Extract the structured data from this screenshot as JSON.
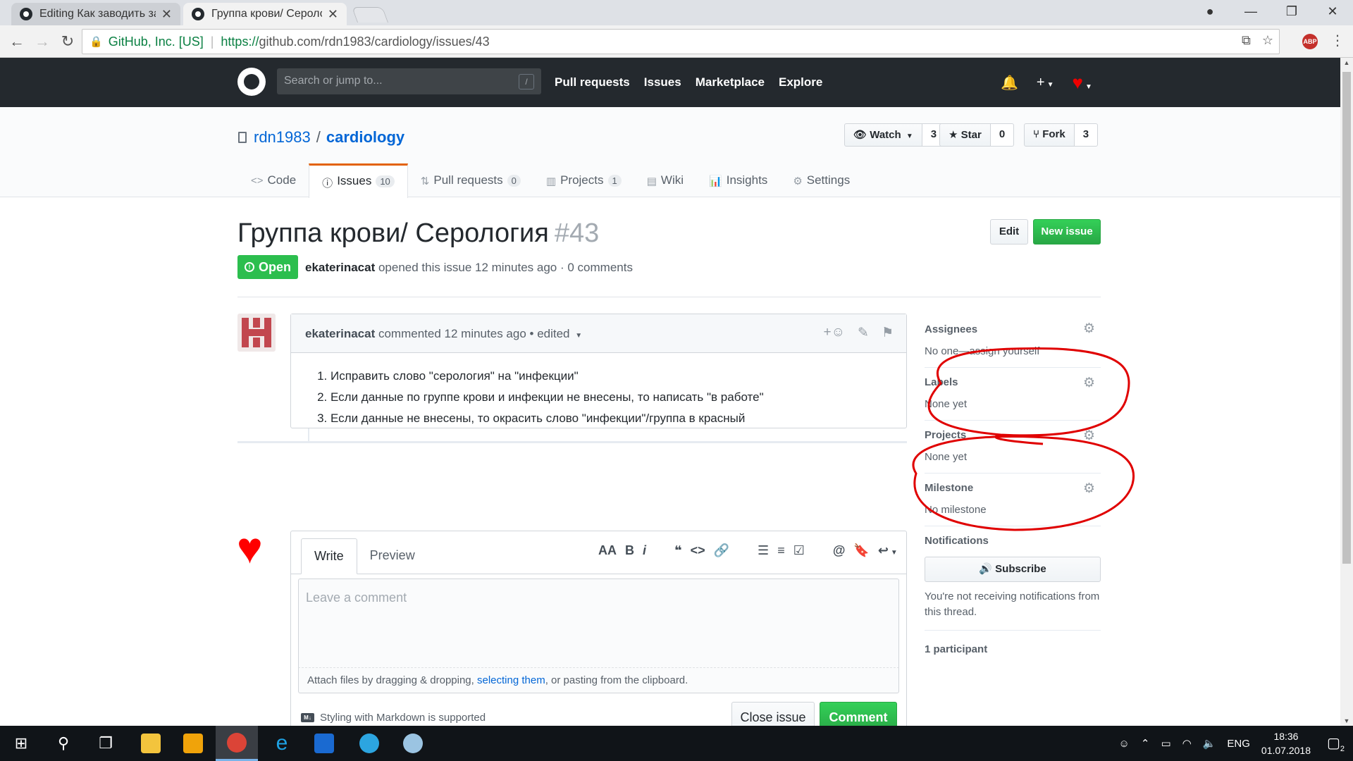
{
  "browser": {
    "tabs": [
      {
        "title": "Editing Как заводить зад",
        "active": false
      },
      {
        "title": "Группа крови/ Серологi",
        "active": true
      }
    ],
    "security_org": "GitHub, Inc. [US]",
    "url_scheme": "https://",
    "url_rest": "github.com/rdn1983/cardiology/issues/43",
    "abp_label": "ABP"
  },
  "gh_header": {
    "search_placeholder": "Search or jump to...",
    "search_key": "/",
    "nav": [
      "Pull requests",
      "Issues",
      "Marketplace",
      "Explore"
    ]
  },
  "repo": {
    "owner": "rdn1983",
    "separator": "/",
    "name": "cardiology",
    "watch_label": "Watch",
    "watch_count": "3",
    "star_label": "Star",
    "star_count": "0",
    "fork_label": "Fork",
    "fork_count": "3",
    "tabs": [
      {
        "label": "Code",
        "count": ""
      },
      {
        "label": "Issues",
        "count": "10"
      },
      {
        "label": "Pull requests",
        "count": "0"
      },
      {
        "label": "Projects",
        "count": "1"
      },
      {
        "label": "Wiki",
        "count": ""
      },
      {
        "label": "Insights",
        "count": ""
      },
      {
        "label": "Settings",
        "count": ""
      }
    ]
  },
  "issue": {
    "title": "Группа крови/ Серология",
    "number": "#43",
    "edit_label": "Edit",
    "new_issue_label": "New issue",
    "state": "Open",
    "author": "ekaterinacat",
    "meta_rest": "opened this issue 12 minutes ago · 0 comments"
  },
  "comment": {
    "author": "ekaterinacat",
    "action": "commented",
    "time": "12 minutes ago",
    "edited": "• edited",
    "items": [
      "Исправить слово \"серология\" на \"инфекции\"",
      "Если данные по группе крови и инфекции не внесены, то написать \"в работе\"",
      "Если данные не внесены, то окрасить слово \"инфекции\"/группа в красный"
    ]
  },
  "new_comment": {
    "tab_write": "Write",
    "tab_preview": "Preview",
    "placeholder": "Leave a comment",
    "attach_pre": "Attach files by dragging & dropping,",
    "attach_link": "selecting them",
    "attach_post": ", or pasting from the clipboard.",
    "markdown_note": "Styling with Markdown is supported",
    "markdown_icon": "M↓",
    "close_label": "Close issue",
    "comment_label": "Comment"
  },
  "sidebar": {
    "assignees_heading": "Assignees",
    "assignees_value": "No one—assign yourself",
    "labels_heading": "Labels",
    "labels_value": "None yet",
    "projects_heading": "Projects",
    "projects_value": "None yet",
    "milestone_heading": "Milestone",
    "milestone_value": "No milestone",
    "notifications_heading": "Notifications",
    "subscribe_label": "Subscribe",
    "notifications_note": "You're not receiving notifications from this thread.",
    "participants": "1 participant"
  },
  "taskbar": {
    "language": "ENG",
    "time": "18:36",
    "date": "01.07.2018",
    "notification_count": "2"
  },
  "colors": {
    "brand_header": "#24292e",
    "link": "#0366d6",
    "open_green": "#2cbe4e",
    "annotation_red": "#e00000",
    "issues_tab_accent": "#e36209"
  }
}
